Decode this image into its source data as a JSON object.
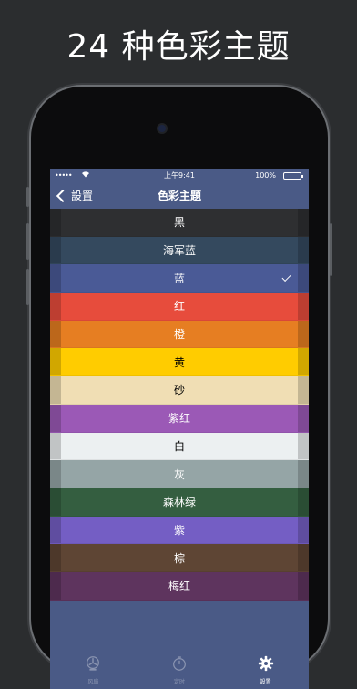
{
  "headline": "24 种色彩主题",
  "status_bar": {
    "signal": "•••••",
    "time": "上午9:41",
    "battery": "100%"
  },
  "navbar": {
    "back_label": "設置",
    "title": "色彩主題"
  },
  "themes": [
    {
      "label": "黑",
      "color": "#2e2f31",
      "text_color": "#ffffff",
      "selected": false
    },
    {
      "label": "海军蓝",
      "color": "#34495e",
      "text_color": "#ffffff",
      "selected": false
    },
    {
      "label": "蓝",
      "color": "#4a5a96",
      "text_color": "#ffffff",
      "selected": true
    },
    {
      "label": "红",
      "color": "#e74c3c",
      "text_color": "#ffffff",
      "selected": false
    },
    {
      "label": "橙",
      "color": "#e67e22",
      "text_color": "#ffffff",
      "selected": false
    },
    {
      "label": "黄",
      "color": "#ffcc00",
      "text_color": "#000000",
      "selected": false
    },
    {
      "label": "砂",
      "color": "#f0deb4",
      "text_color": "#000000",
      "selected": false
    },
    {
      "label": "紫红",
      "color": "#9b59b6",
      "text_color": "#ffffff",
      "selected": false
    },
    {
      "label": "白",
      "color": "#ecf0f1",
      "text_color": "#000000",
      "selected": false
    },
    {
      "label": "灰",
      "color": "#95a5a6",
      "text_color": "#ffffff",
      "selected": false
    },
    {
      "label": "森林绿",
      "color": "#345e40",
      "text_color": "#ffffff",
      "selected": false
    },
    {
      "label": "紫",
      "color": "#745ec4",
      "text_color": "#ffffff",
      "selected": false
    },
    {
      "label": "棕",
      "color": "#5e4534",
      "text_color": "#ffffff",
      "selected": false
    },
    {
      "label": "梅红",
      "color": "#5e345e",
      "text_color": "#ffffff",
      "selected": false
    }
  ],
  "tabbar": {
    "tabs": [
      {
        "label": "风扇",
        "icon": "fan-icon",
        "active": false
      },
      {
        "label": "定时",
        "icon": "timer-icon",
        "active": false
      },
      {
        "label": "設置",
        "icon": "gear-icon",
        "active": true
      }
    ]
  }
}
